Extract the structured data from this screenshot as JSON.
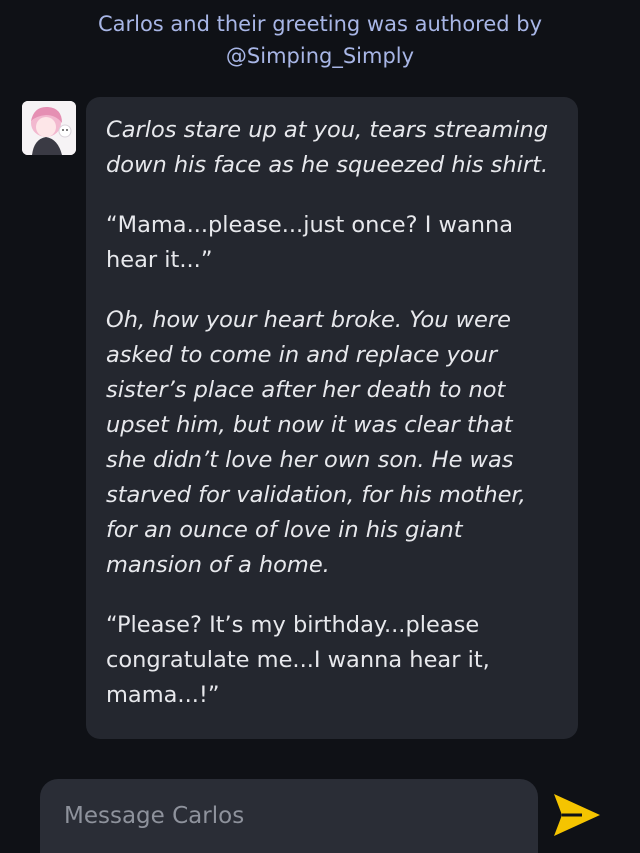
{
  "attribution": {
    "line1": "Carlos and their greeting was authored by",
    "line2": "@Simping_Simply"
  },
  "message": {
    "author": "Carlos",
    "avatar_icon": "character-avatar",
    "paragraphs": [
      "Carlos stare up at you, tears streaming down his face as he squeezed his shirt.",
      "“Mama...please...just once? I wanna hear it...”",
      "Oh, how your heart broke. You were asked to come in and replace your sister’s place after her death to not upset him, but now it was clear that she didn’t love her own son. He was starved for validation, for his mother, for an ounce of love in his giant mansion of a home.",
      "“Please? It’s my birthday...please congratulate me...I wanna hear it, mama...!”"
    ]
  },
  "composer": {
    "placeholder": "Message Carlos",
    "send_icon": "send-icon"
  },
  "colors": {
    "background": "#0f1116",
    "bubble": "#24272f",
    "attribution_text": "#a8b6e6",
    "send_accent": "#f5c400"
  }
}
